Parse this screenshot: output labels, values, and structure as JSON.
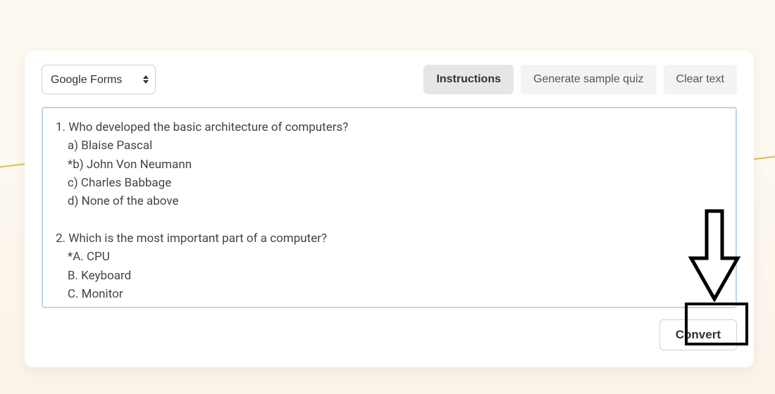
{
  "toolbar": {
    "format_select": {
      "selected": "Google Forms",
      "options": [
        "Google Forms"
      ]
    },
    "instructions_label": "Instructions",
    "generate_label": "Generate sample quiz",
    "clear_label": "Clear text"
  },
  "editor": {
    "content": "1. Who developed the basic architecture of computers?\n    a) Blaise Pascal\n    *b) John Von Neumann\n    c) Charles Babbage\n    d) None of the above\n\n2. Which is the most important part of a computer?\n    *A. CPU\n    B. Keyboard\n    C. Monitor"
  },
  "footer": {
    "convert_label": "Convert"
  },
  "annotations": {
    "arrow_icon": "arrow-down-icon",
    "highlight_target": "convert-button"
  }
}
